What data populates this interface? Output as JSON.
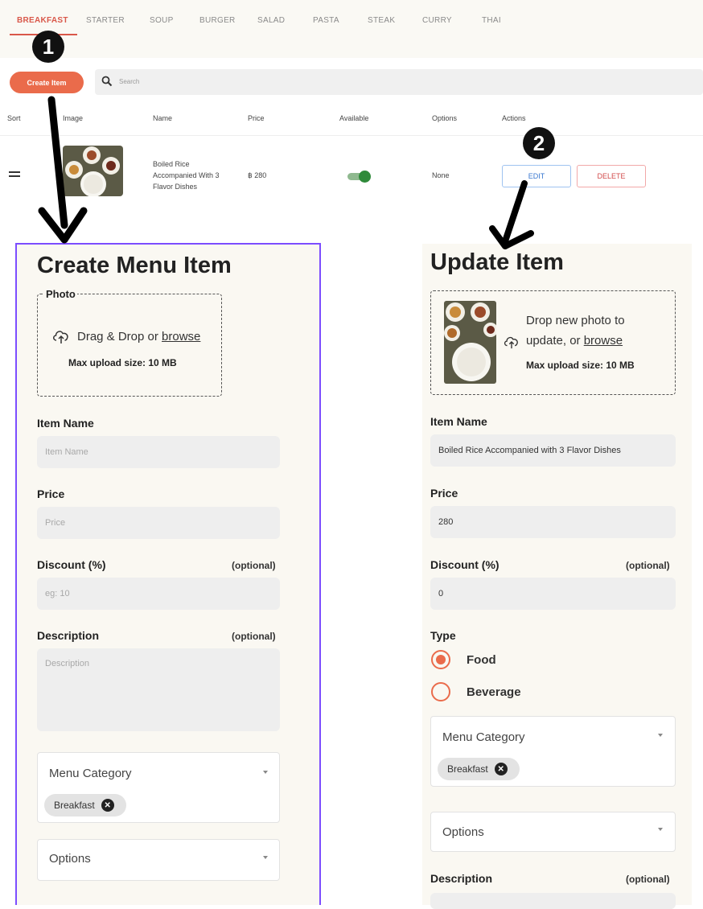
{
  "tabs": [
    {
      "label": "BREAKFAST",
      "active": true
    },
    {
      "label": "STARTER"
    },
    {
      "label": "SOUP"
    },
    {
      "label": "BURGER"
    },
    {
      "label": "SALAD"
    },
    {
      "label": "PASTA"
    },
    {
      "label": "STEAK"
    },
    {
      "label": "CURRY"
    },
    {
      "label": "THAI"
    }
  ],
  "toolbar": {
    "create_label": "Create Item",
    "search_placeholder": "Search"
  },
  "table": {
    "headers": [
      "Sort",
      "Image",
      "Name",
      "Price",
      "Available",
      "Options",
      "Actions"
    ],
    "row": {
      "name": "Boiled Rice Accompanied With 3 Flavor Dishes",
      "price": "฿ 280",
      "available": true,
      "options": "None",
      "edit_label": "EDIT",
      "delete_label": "DELETE"
    }
  },
  "annotations": {
    "badge1": "1",
    "badge2": "2"
  },
  "create_form": {
    "title": "Create Menu Item",
    "photo_legend": "Photo",
    "drop_text": "Drag & Drop or ",
    "browse": "browse",
    "max_upload": "Max upload size: 10 MB",
    "item_name_label": "Item Name",
    "item_name_placeholder": "Item Name",
    "price_label": "Price",
    "price_placeholder": "Price",
    "discount_label": "Discount (%)",
    "optional": "(optional)",
    "discount_placeholder": "eg: 10",
    "description_label": "Description",
    "description_placeholder": "Description",
    "menu_category_label": "Menu Category",
    "category_chip": "Breakfast",
    "options_label": "Options"
  },
  "update_form": {
    "title": "Update Item",
    "drop_line1": "Drop new photo to",
    "drop_line2": "update, or ",
    "browse": "browse",
    "max_upload": "Max upload size: 10 MB",
    "item_name_label": "Item Name",
    "item_name_value": "Boiled Rice Accompanied with 3 Flavor Dishes",
    "price_label": "Price",
    "price_value": "280",
    "discount_label": "Discount (%)",
    "optional": "(optional)",
    "discount_value": "0",
    "type_label": "Type",
    "type_food": "Food",
    "type_beverage": "Beverage",
    "type_selected": "Food",
    "menu_category_label": "Menu Category",
    "category_chip": "Breakfast",
    "options_label": "Options",
    "description_label": "Description"
  },
  "colors": {
    "accent": "#ea6b4b",
    "tab_active": "#d9584a",
    "panel_border": "#7c4dff",
    "toggle_on": "#2f8a3a"
  }
}
